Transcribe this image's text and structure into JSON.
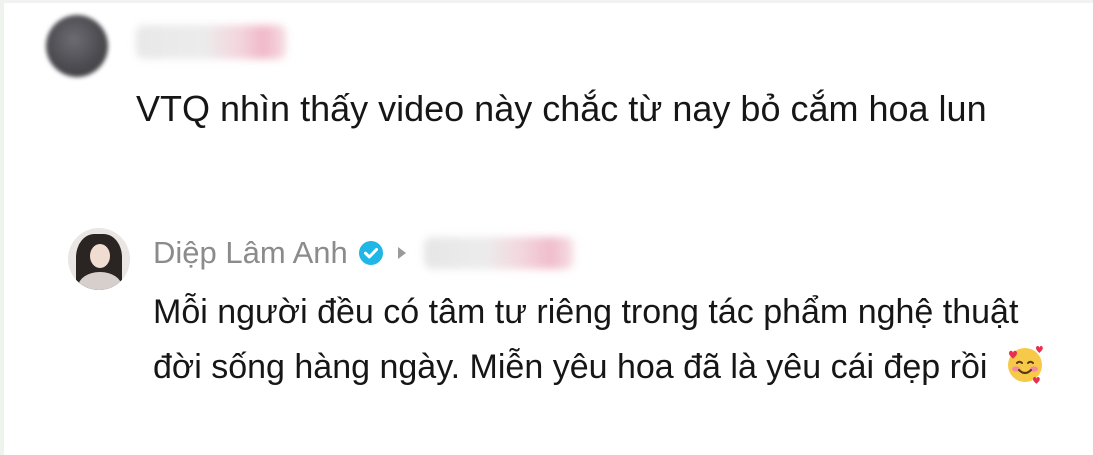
{
  "parent_comment": {
    "avatar": "blurred-avatar",
    "username": "",
    "text": "VTQ nhìn thấy video này chắc từ nay bỏ cắm hoa lun"
  },
  "reply": {
    "author_name": "Diệp Lâm Anh",
    "verified_icon": "verified-check-icon",
    "reply_arrow_icon": "play-arrow-icon",
    "replying_to": "",
    "text": "Mỗi người đều có tâm tư riêng trong tác phẩm nghệ thuật đời sống hàng ngày. Miễn yêu hoa đã là yêu cái đẹp rồi",
    "emoji": "🥰"
  },
  "colors": {
    "author_name": "#8b8b8b",
    "body_text": "#161616",
    "verified_badge": "#20b7e6"
  }
}
